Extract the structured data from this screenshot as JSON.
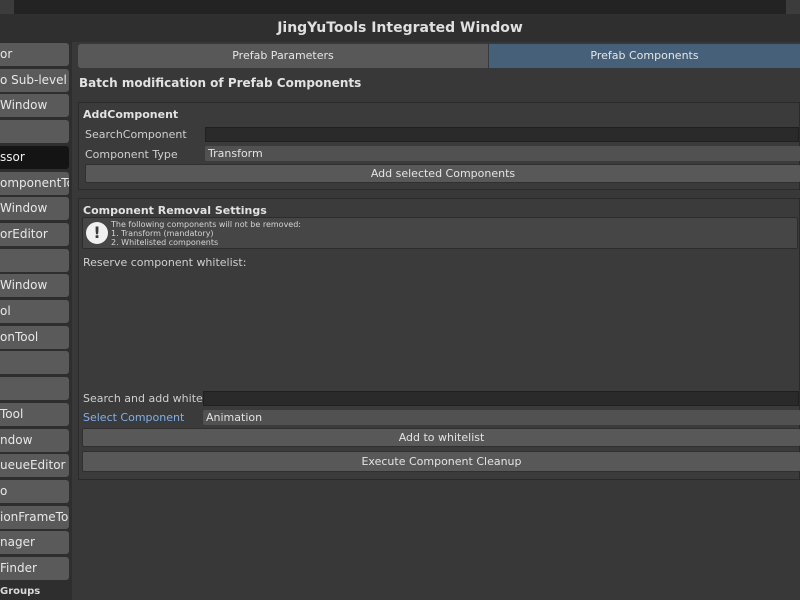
{
  "window": {
    "title": "JingYuTools Integrated Window"
  },
  "sidebar": {
    "items": [
      {
        "label": "or",
        "selected": false
      },
      {
        "label": "o Sub-level",
        "selected": false
      },
      {
        "label": "Window",
        "selected": false
      },
      {
        "label": "",
        "selected": false
      },
      {
        "label": "ssor",
        "selected": true
      },
      {
        "label": "omponentTool",
        "selected": false
      },
      {
        "label": "Window",
        "selected": false
      },
      {
        "label": "orEditor",
        "selected": false
      },
      {
        "label": "",
        "selected": false
      },
      {
        "label": "Window",
        "selected": false
      },
      {
        "label": "ol",
        "selected": false
      },
      {
        "label": "onTool",
        "selected": false
      },
      {
        "label": "",
        "selected": false
      },
      {
        "label": "",
        "selected": false
      },
      {
        "label": "Tool",
        "selected": false
      },
      {
        "label": "ndow",
        "selected": false
      },
      {
        "label": "ueueEditor",
        "selected": false
      },
      {
        "label": "o",
        "selected": false
      },
      {
        "label": "ionFrameTool",
        "selected": false
      },
      {
        "label": "nager",
        "selected": false
      },
      {
        "label": "Finder",
        "selected": false
      }
    ],
    "footer_label": "Groups"
  },
  "tabs": [
    {
      "label": "Prefab Parameters",
      "active": false
    },
    {
      "label": "Prefab Components",
      "active": true
    }
  ],
  "section_title": "Batch modification of Prefab Components",
  "add_component": {
    "header": "AddComponent",
    "search_label": "SearchComponent",
    "search_value": "",
    "type_label": "Component Type",
    "type_value": "Transform",
    "add_button": "Add selected Components"
  },
  "removal": {
    "header": "Component Removal Settings",
    "help_lines": [
      "The following components will not be removed:",
      "1. Transform (mandatory)",
      "2. Whitelisted components"
    ],
    "whitelist_label": "Reserve component whitelist:",
    "search_label": "Search and add whitelist",
    "search_value": "",
    "select_label": "Select Component",
    "select_value": "Animation",
    "add_whitelist_button": "Add to whitelist",
    "execute_button": "Execute Component Cleanup"
  },
  "colors": {
    "active_tab": "#46607a",
    "accent_label": "#7fb0e8",
    "selected_item": "#141414"
  }
}
